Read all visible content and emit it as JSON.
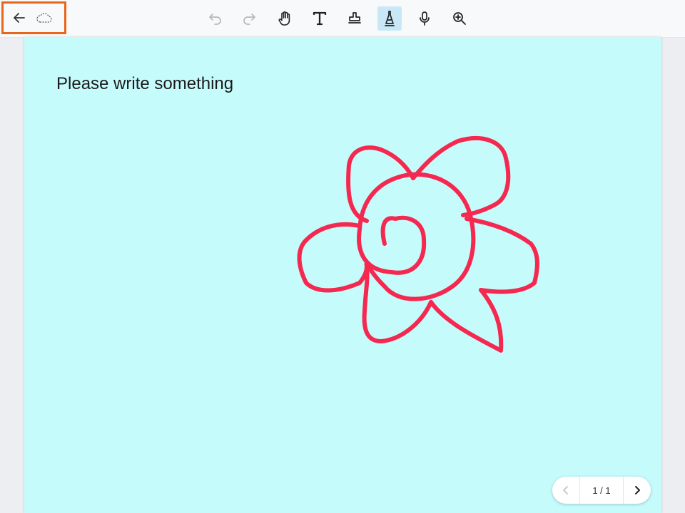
{
  "toolbar": {
    "left": [
      {
        "name": "back",
        "icon": "arrow-left-icon"
      },
      {
        "name": "cloud-sync",
        "icon": "cloud-dashed-icon"
      }
    ],
    "tools": [
      {
        "name": "undo",
        "icon": "undo-icon",
        "enabled": false
      },
      {
        "name": "redo",
        "icon": "redo-icon",
        "enabled": false
      },
      {
        "name": "hand",
        "icon": "hand-icon"
      },
      {
        "name": "text",
        "icon": "text-icon"
      },
      {
        "name": "stamp",
        "icon": "stamp-icon"
      },
      {
        "name": "pen",
        "icon": "pen-nib-icon",
        "active": true
      },
      {
        "name": "voice",
        "icon": "microphone-icon"
      },
      {
        "name": "zoom",
        "icon": "zoom-in-icon"
      }
    ],
    "highlight_color": "#e8661a",
    "active_tool_color": "#c9e8f7"
  },
  "canvas": {
    "background": "#c6fbfc",
    "prompt_text": "Please write something",
    "stroke_color": "#f5284f",
    "drawing": "flower-sketch"
  },
  "pager": {
    "page_indicator": "1 / 1",
    "prev_enabled": false,
    "next_enabled": true
  }
}
